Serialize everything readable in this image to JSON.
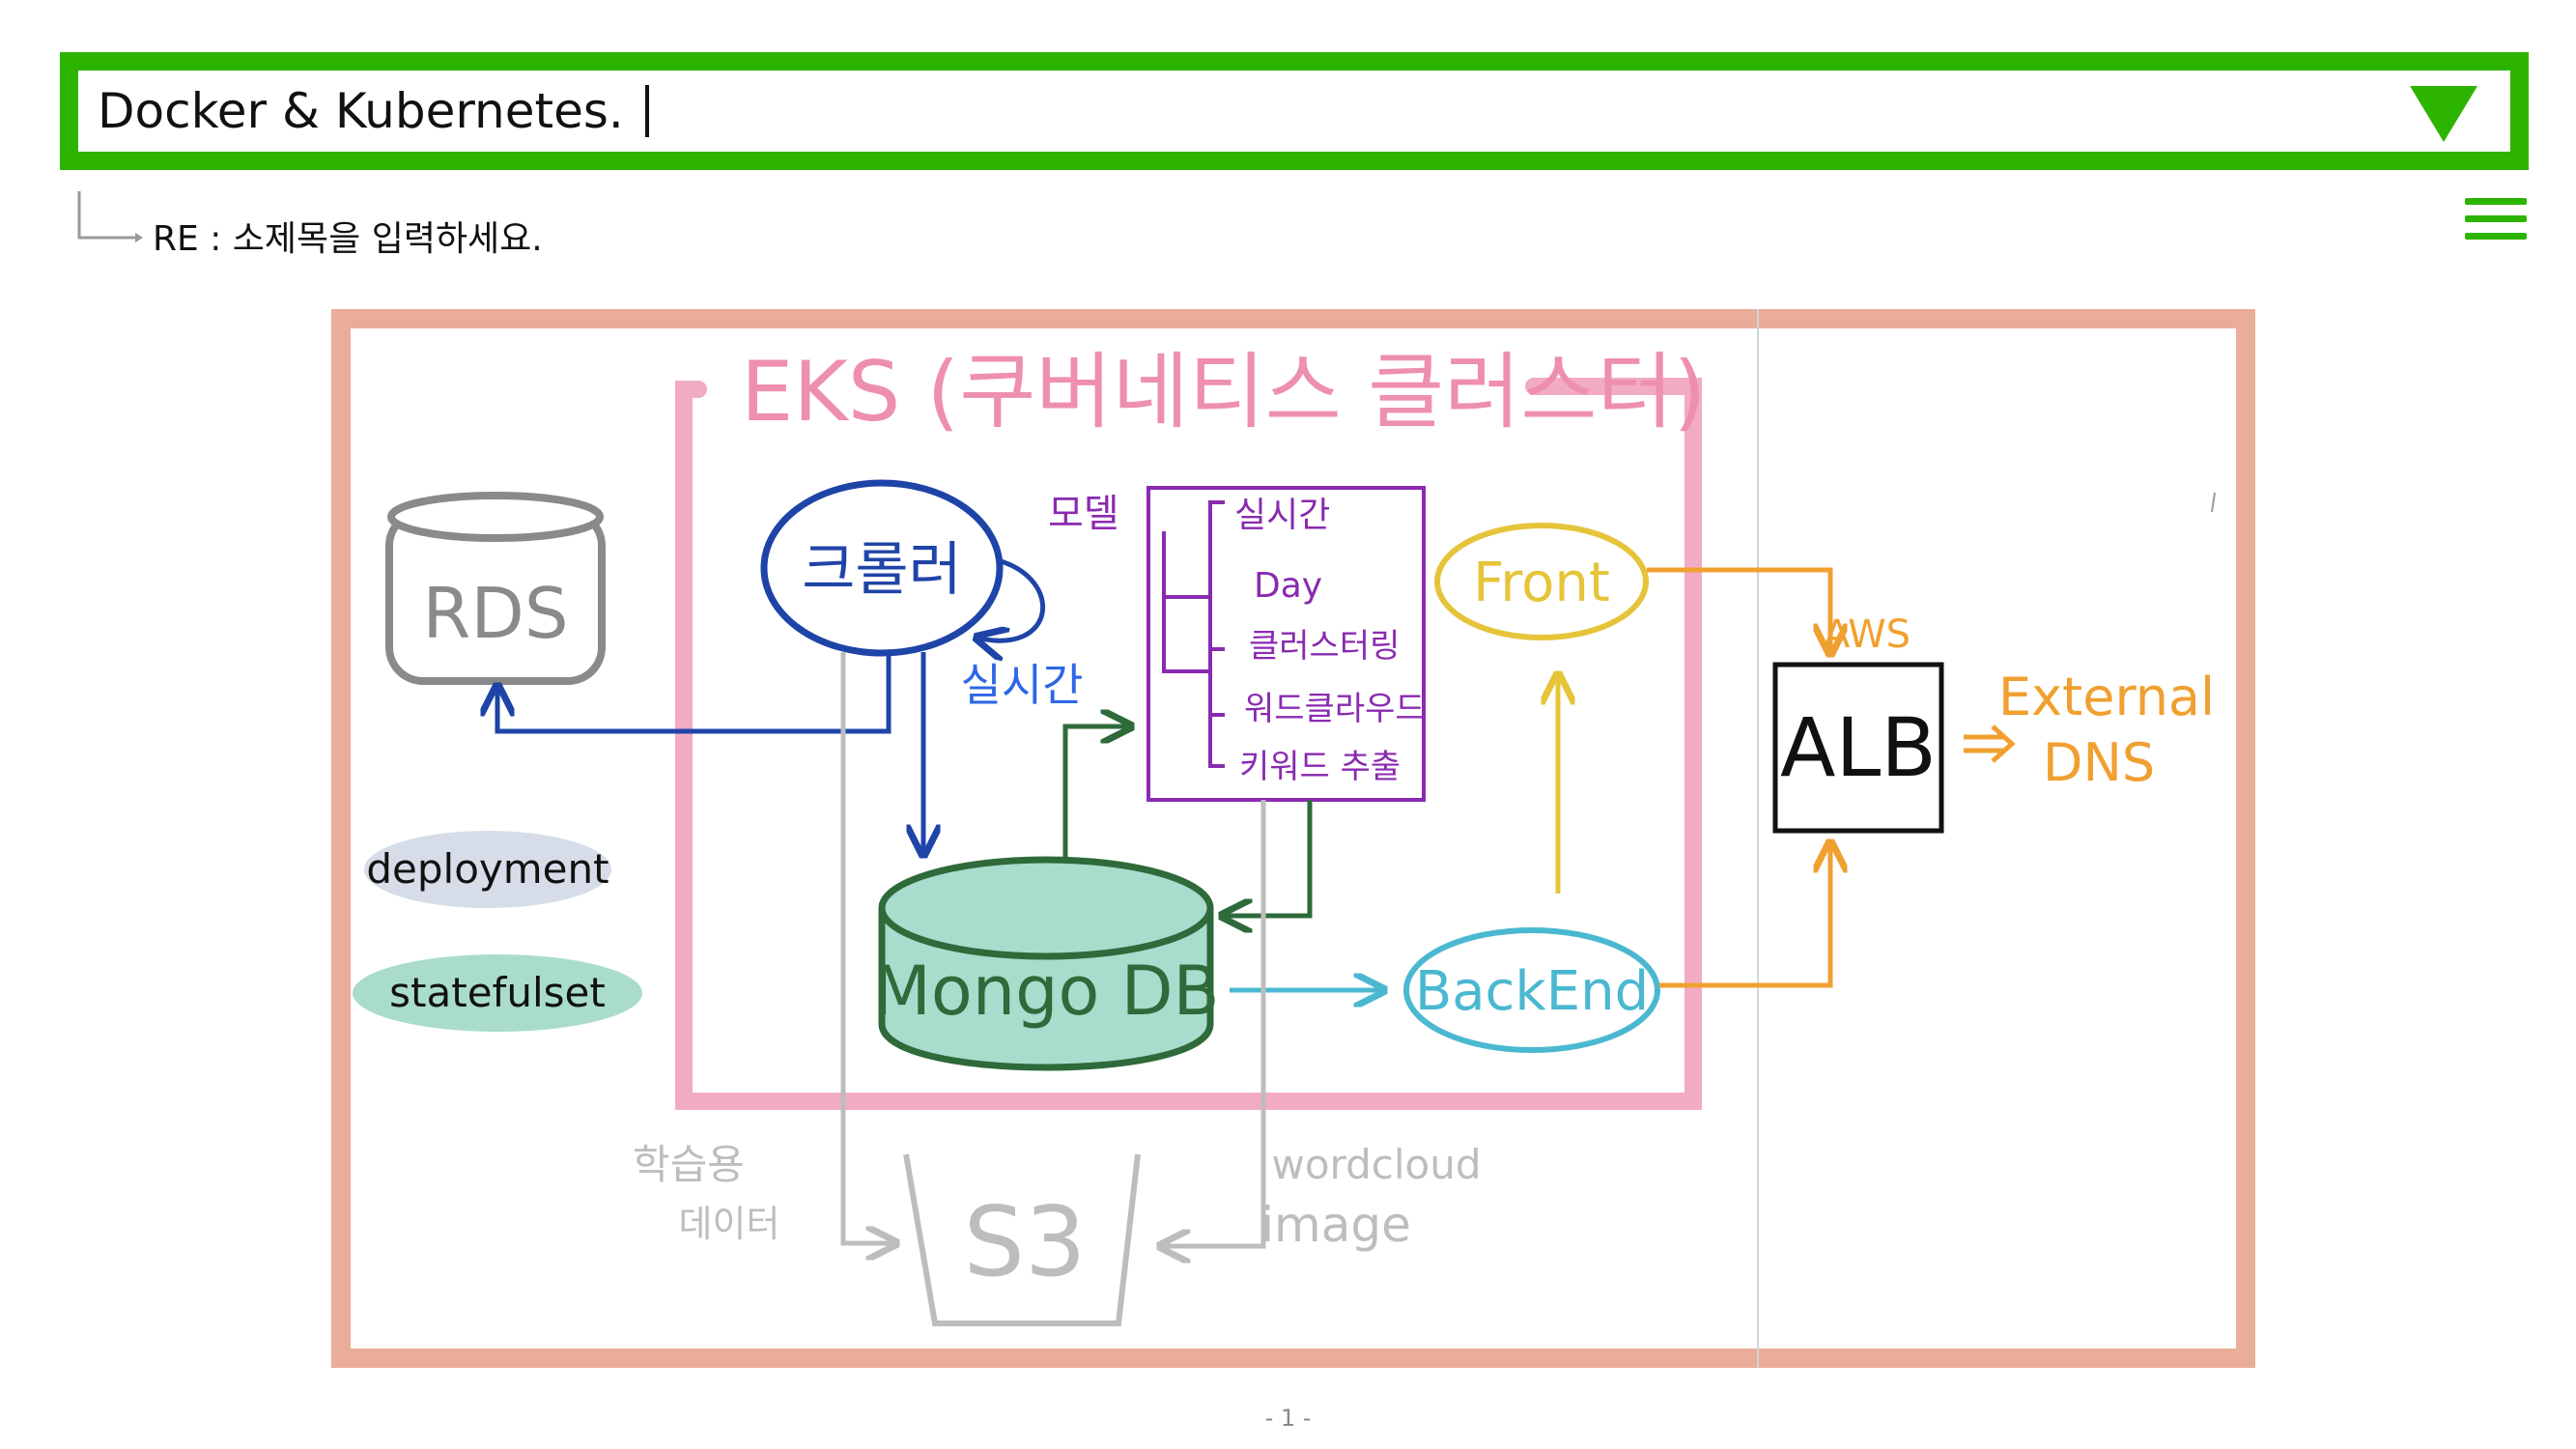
{
  "header": {
    "title": "Docker & Kubernetes.",
    "subtitle": "RE : 소제목을 입력하세요.",
    "colors": {
      "accent": "#2db400"
    },
    "icons": {
      "dropdown": "triangle-down-icon",
      "menu": "hamburger-menu-icon"
    }
  },
  "diagram": {
    "eks_title": "EKS (쿠버네티스 클러스터)",
    "rds": "RDS",
    "crawler": "크롤러",
    "crawler_loop_label": "실시간",
    "model_label": "모델",
    "model_items": [
      "실시간",
      "Day",
      "클러스터링",
      "워드클라우드",
      "키워드 추출"
    ],
    "mongodb": "Mongo DB",
    "front": "Front",
    "backend": "BackEnd",
    "aws": "AWS",
    "alb": "ALB",
    "external_dns_line1": "External",
    "external_dns_line2": "DNS",
    "s3": "S3",
    "training_data_line1": "학습용",
    "training_data_line2": "데이터",
    "wordcloud_line1": "wordcloud",
    "wordcloud_line2": "image",
    "legend": [
      "deployment",
      "statefulset"
    ],
    "colors": {
      "frame": "#e8a590",
      "eks": "#ee8fb0",
      "crawler": "#1f44a8",
      "mongodb_fill": "#a9dccd",
      "mongodb_stroke": "#2e6a3a",
      "model": "#8a2ab0",
      "front": "#e6c43a",
      "backend": "#4ab8d0",
      "external": "#f0a030",
      "s3": "#bdbdbd",
      "rds": "#8a8a8a",
      "deployment_bg": "#d6dde8",
      "statefulset_bg": "#a9dccd"
    }
  },
  "footer": {
    "page": "- 1 -"
  }
}
